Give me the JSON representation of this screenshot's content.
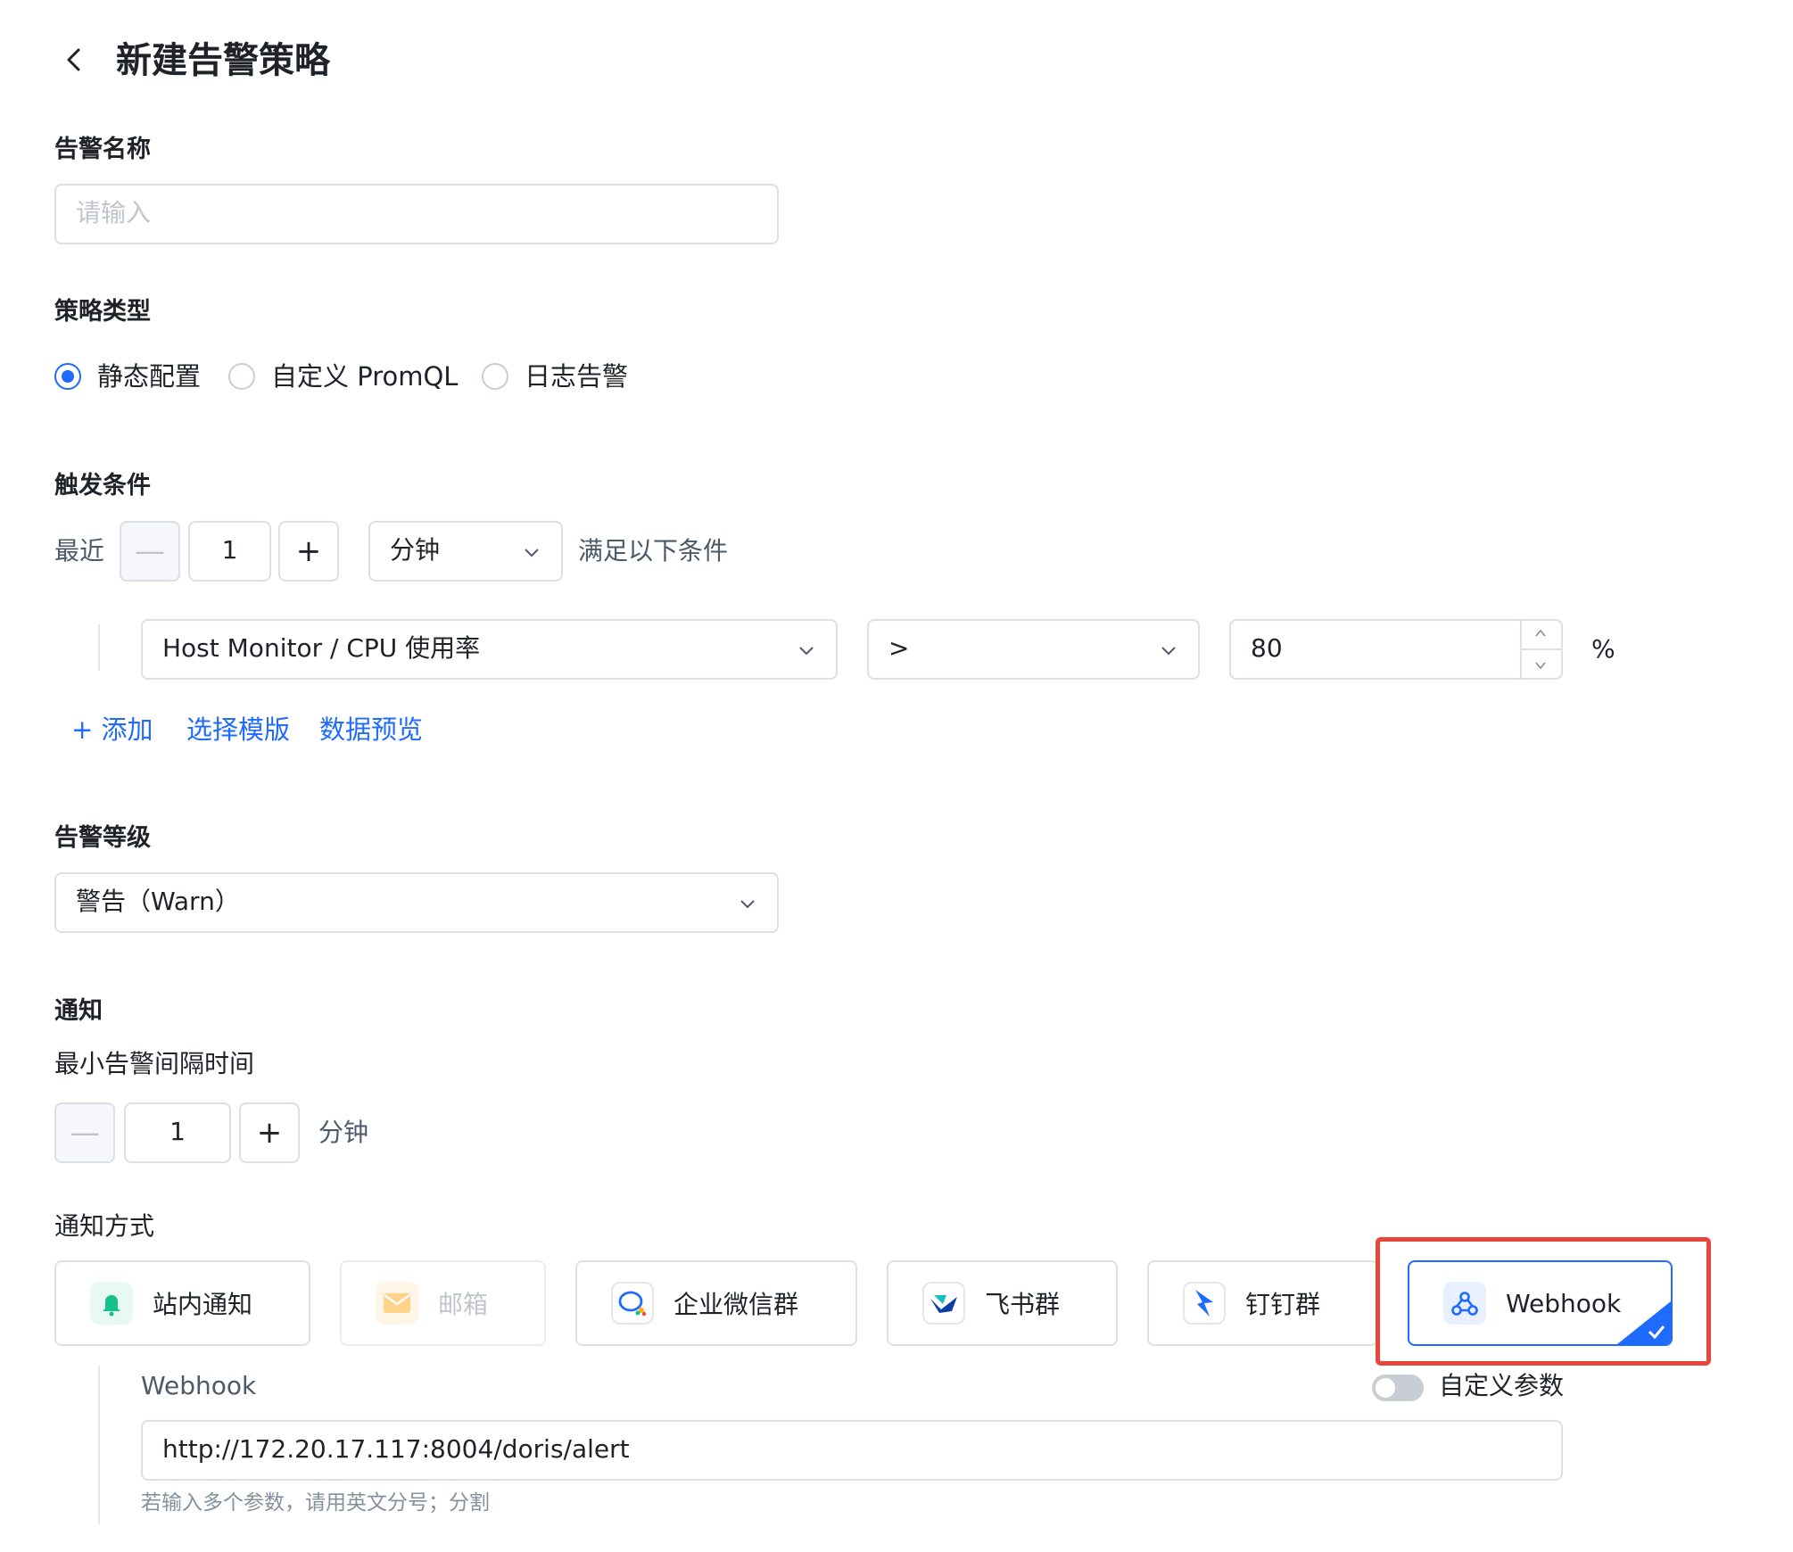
{
  "header": {
    "title": "新建告警策略"
  },
  "alert_name": {
    "label": "告警名称",
    "placeholder": "请输入"
  },
  "strategy_type": {
    "label": "策略类型",
    "options": [
      "静态配置",
      "自定义 PromQL",
      "日志告警"
    ],
    "selected": "静态配置"
  },
  "trigger": {
    "label": "触发条件",
    "recent_label": "最近",
    "minus": "—",
    "plus": "+",
    "count": "1",
    "unit": "分钟",
    "suffix": "满足以下条件",
    "metric": "Host Monitor / CPU 使用率",
    "operator": ">",
    "threshold": "80",
    "percent": "%",
    "actions": [
      "+ 添加",
      "选择模版",
      "数据预览"
    ]
  },
  "level": {
    "label": "告警等级",
    "value": "警告（Warn）"
  },
  "notify": {
    "label": "通知",
    "interval_label": "最小告警间隔时间",
    "minus": "—",
    "plus": "+",
    "interval_value": "1",
    "interval_unit": "分钟",
    "method_label": "通知方式",
    "methods": [
      {
        "label": "站内通知",
        "icon": "bell-icon"
      },
      {
        "label": "邮箱",
        "icon": "mail-icon"
      },
      {
        "label": "企业微信群",
        "icon": "wecom-icon"
      },
      {
        "label": "飞书群",
        "icon": "feishu-icon"
      },
      {
        "label": "钉钉群",
        "icon": "dingtalk-icon"
      },
      {
        "label": "Webhook",
        "icon": "webhook-icon"
      }
    ],
    "selected_method": "Webhook",
    "webhook_label": "Webhook",
    "custom_param_label": "自定义参数",
    "custom_param_on": false,
    "webhook_url": "http://172.20.17.117:8004/doris/alert",
    "hint": "若输入多个参数，请用英文分号；分割"
  },
  "colors": {
    "primary": "#1f6bff",
    "highlight_box": "#e8453c"
  }
}
